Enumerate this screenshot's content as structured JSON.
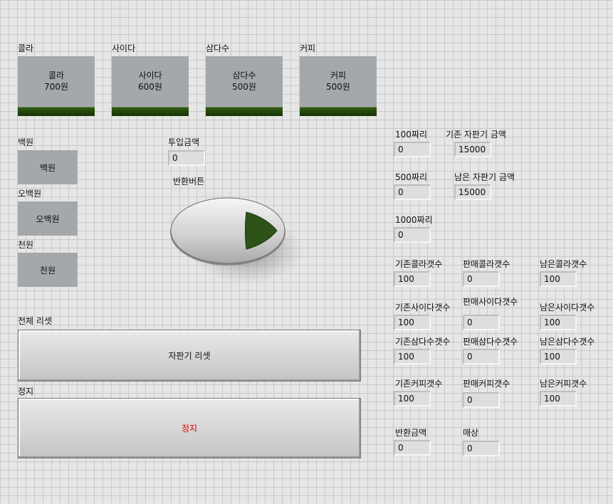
{
  "products": [
    {
      "title": "콜라",
      "name": "콜라",
      "price": "700원"
    },
    {
      "title": "사이다",
      "name": "사이다",
      "price": "600원"
    },
    {
      "title": "삼다수",
      "name": "삼다수",
      "price": "500원"
    },
    {
      "title": "커피",
      "name": "커피",
      "price": "500원"
    }
  ],
  "coins": [
    {
      "title": "백원",
      "label": "백원"
    },
    {
      "title": "오백원",
      "label": "오백원"
    },
    {
      "title": "천원",
      "label": "천원"
    }
  ],
  "inserted": {
    "label": "투입금액",
    "value": "0"
  },
  "return_button": {
    "label": "반환버튼"
  },
  "counts": [
    {
      "label": "100짜리",
      "value": "0"
    },
    {
      "label": "500짜리",
      "value": "0"
    },
    {
      "label": "1000짜리",
      "value": "0"
    }
  ],
  "machine": {
    "existing_label": "기존 자판기 금액",
    "existing_value": "15000",
    "remaining_label": "남은 자판기 금액",
    "remaining_value": "15000"
  },
  "stock": [
    {
      "existing_label": "기존콜라갯수",
      "existing": "100",
      "sold_label": "판매콜라갯수",
      "sold": "0",
      "remaining_label": "남은콜라갯수",
      "remaining": "100"
    },
    {
      "existing_label": "기존사이다갯수",
      "existing": "100",
      "sold_label": "판매사이다갯수",
      "sold": "0",
      "remaining_label": "남은사이다갯수",
      "remaining": "100"
    },
    {
      "existing_label": "기존삼다수갯수",
      "existing": "100",
      "sold_label": "판매삼다수갯수",
      "sold": "0",
      "remaining_label": "남은삼다수갯수",
      "remaining": "100"
    },
    {
      "existing_label": "기존커피갯수",
      "existing": "100",
      "sold_label": "판매커피갯수",
      "sold": "0",
      "remaining_label": "남은커피갯수",
      "remaining": "100"
    }
  ],
  "change": {
    "label": "반환금액",
    "value": "0"
  },
  "sales": {
    "label": "매상",
    "value": "0"
  },
  "reset": {
    "title": "전체 리셋",
    "label": "자판기 리셋"
  },
  "stop": {
    "title": "정지",
    "label": "정지",
    "color": "#e00000"
  },
  "colors": {
    "led": "#2f5a12",
    "arrow": "#2e5318",
    "button_face": "#a4a8aa"
  }
}
